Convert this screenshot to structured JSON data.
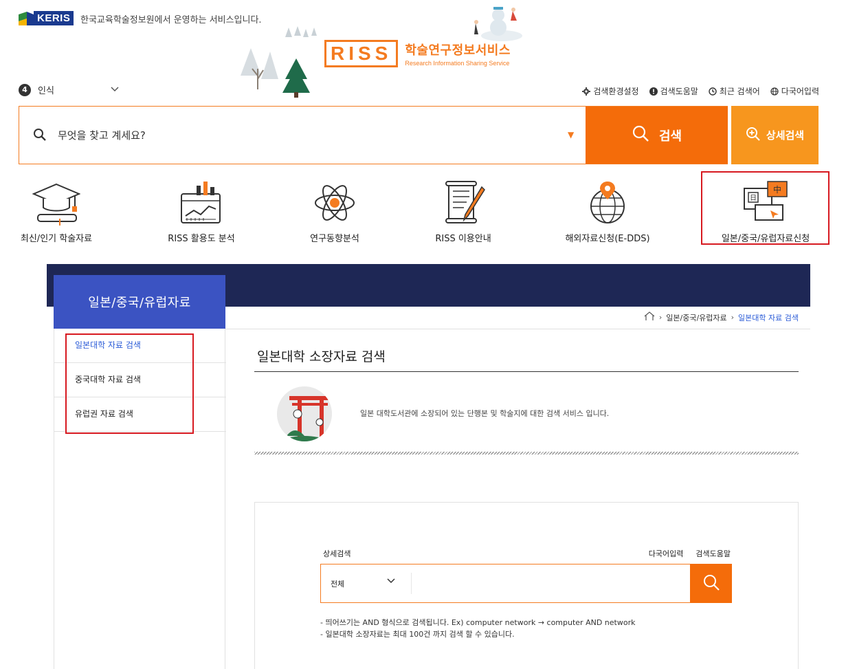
{
  "header": {
    "org_logo_text": "KERIS",
    "org_description": "한국교육학술정보원에서 운영하는 서비스입니다.",
    "service_logo_text": "RISS",
    "service_name": "학술연구정보서비스",
    "service_name_en": "Research Information Sharing Service",
    "accessibility": {
      "badge": "4",
      "label": "인식"
    },
    "util_links": [
      {
        "label": "검색환경설정",
        "icon": "gear-icon"
      },
      {
        "label": "검색도움말",
        "icon": "info-icon"
      },
      {
        "label": "최근 검색어",
        "icon": "clock-icon"
      },
      {
        "label": "다국어입력",
        "icon": "globe-icon"
      }
    ]
  },
  "main_search": {
    "placeholder": "무엇을 찾고 계세요?",
    "search_button": "검색",
    "advanced_button": "상세검색"
  },
  "quick_menu": [
    {
      "label": "최신/인기 학술자료",
      "icon": "graduation-cap-icon"
    },
    {
      "label": "RISS 활용도 분석",
      "icon": "analytics-chart-icon"
    },
    {
      "label": "연구동향분석",
      "icon": "atom-icon"
    },
    {
      "label": "RISS 이용안내",
      "icon": "guide-scroll-icon"
    },
    {
      "label": "해외자료신청(E-DDS)",
      "icon": "globe-pin-icon"
    },
    {
      "label": "일본/중국/유럽자료신청",
      "icon": "language-monitor-icon"
    }
  ],
  "lnb": {
    "title": "일본/중국/유럽자료",
    "items": [
      {
        "label": "일본대학 자료 검색",
        "active": true
      },
      {
        "label": "중국대학 자료 검색",
        "active": false
      },
      {
        "label": "유럽권 자료 검색",
        "active": false
      }
    ]
  },
  "breadcrumb": {
    "level1": "일본/중국/유럽자료",
    "current": "일본대학 자료 검색"
  },
  "content": {
    "page_title": "일본대학 소장자료 검색",
    "intro": "일본 대학도서관에 소장되어 있는 단행본 및 학술지에 대한 검색 서비스 입니다.",
    "advanced_label": "상세검색",
    "multilang_link": "다국어입력",
    "help_link": "검색도움말",
    "scope_selected": "전체",
    "notes": [
      "- 띄어쓰기는 AND 형식으로 검색됩니다. Ex) computer network → computer AND network",
      "- 일본대학 소장자료는 최대 100건 까지 검색 할 수 있습니다."
    ]
  },
  "colors": {
    "primary_orange": "#f46c0a",
    "secondary_orange": "#f7961e",
    "navy": "#1e2755",
    "lnb_blue": "#3b53c2",
    "highlight_red": "#d71920",
    "link_blue": "#2a5bd7"
  }
}
